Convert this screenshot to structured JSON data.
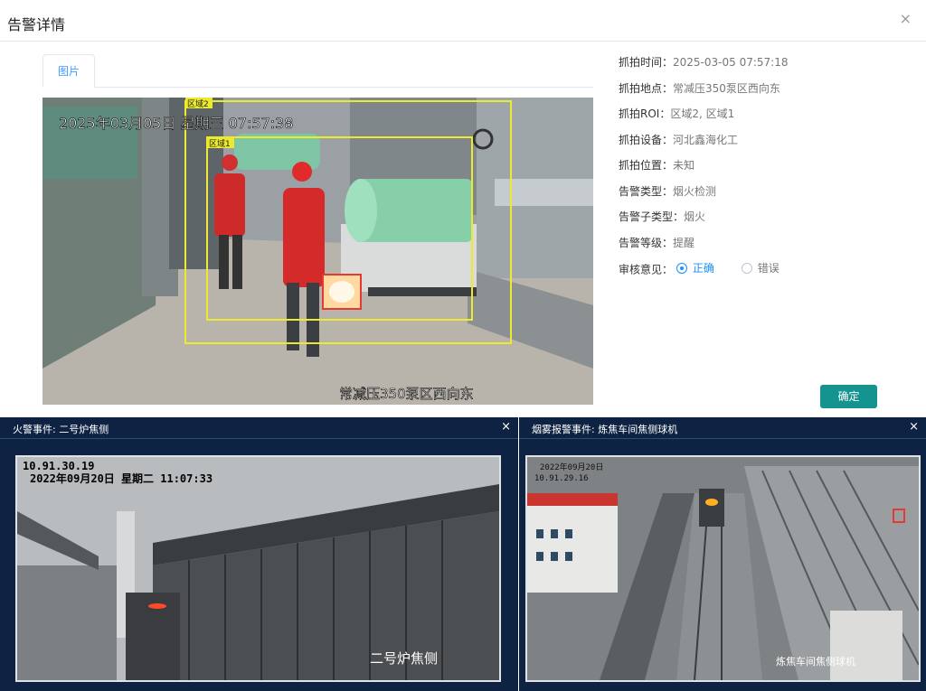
{
  "dialog": {
    "title": "告警详情",
    "close": "×",
    "tab": "图片",
    "confirm": "确定",
    "camera": {
      "timestamp": "2025年03月05日 星期三 07:57:38",
      "location_overlay": "常减压350泵区西向东",
      "roi_labels": [
        "区域2",
        "区域1"
      ]
    },
    "info": [
      {
        "label": "抓拍时间：",
        "value": "2025-03-05 07:57:18"
      },
      {
        "label": "抓拍地点：",
        "value": "常减压350泵区西向东"
      },
      {
        "label": "抓拍ROI：",
        "value": "区域2, 区域1"
      },
      {
        "label": "抓拍设备：",
        "value": "河北鑫海化工"
      },
      {
        "label": "抓拍位置：",
        "value": "未知"
      },
      {
        "label": "告警类型：",
        "value": "烟火检测"
      },
      {
        "label": "告警子类型：",
        "value": "烟火"
      },
      {
        "label": "告警等级：",
        "value": "提醒"
      }
    ],
    "review": {
      "label": "审核意见：",
      "options": [
        "正确",
        "错误"
      ],
      "selected": "正确"
    }
  },
  "popups": [
    {
      "title": "火警事件: 二号炉焦侧",
      "close": "×",
      "ip": "10.91.30.19",
      "timestamp": "2022年09月20日  星期二  11:07:33",
      "location": "二号炉焦侧"
    },
    {
      "title": "烟雾报警事件: 炼焦车间焦侧球机",
      "close": "×",
      "ip": "10.91.29.16",
      "timestamp": "2022年09月20日",
      "location": "炼焦车间焦侧球机"
    }
  ],
  "colors": {
    "accent": "#1890ff",
    "confirm_button": "#15938f",
    "popup_bg": "#0e2343",
    "roi_box": "#ecea2e",
    "fire_box": "#e53935"
  }
}
